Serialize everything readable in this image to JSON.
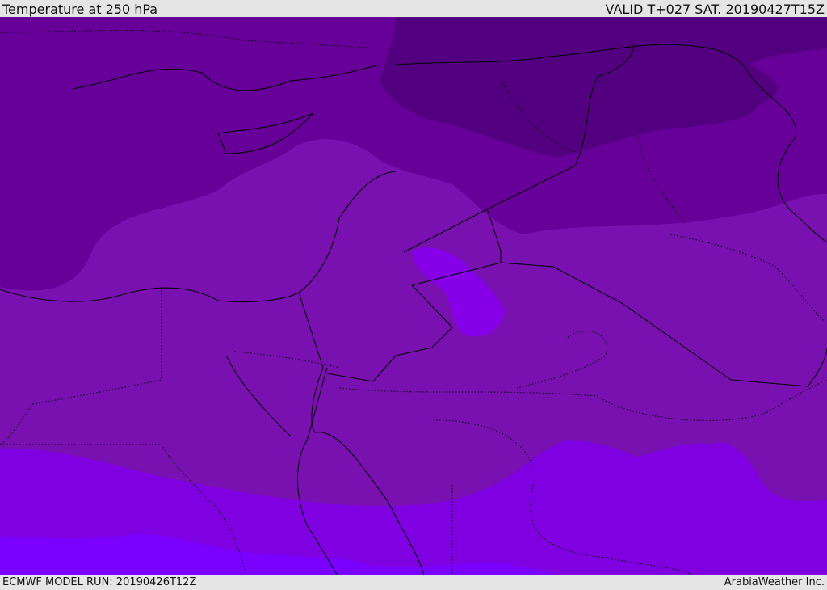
{
  "header": {
    "title": "Temperature at 250 hPa",
    "valid": "VALID T+027 SAT. 20190427T15Z"
  },
  "footer": {
    "model_run": "ECMWF MODEL RUN: 20190426T12Z",
    "credit": "ArabiaWeather Inc."
  },
  "colors": {
    "coldest": "#530080",
    "cold": "#660099",
    "mid": "#7910b0",
    "warm": "#7f00e0",
    "warmest": "#7a00ff",
    "blob": "#8600e8"
  }
}
